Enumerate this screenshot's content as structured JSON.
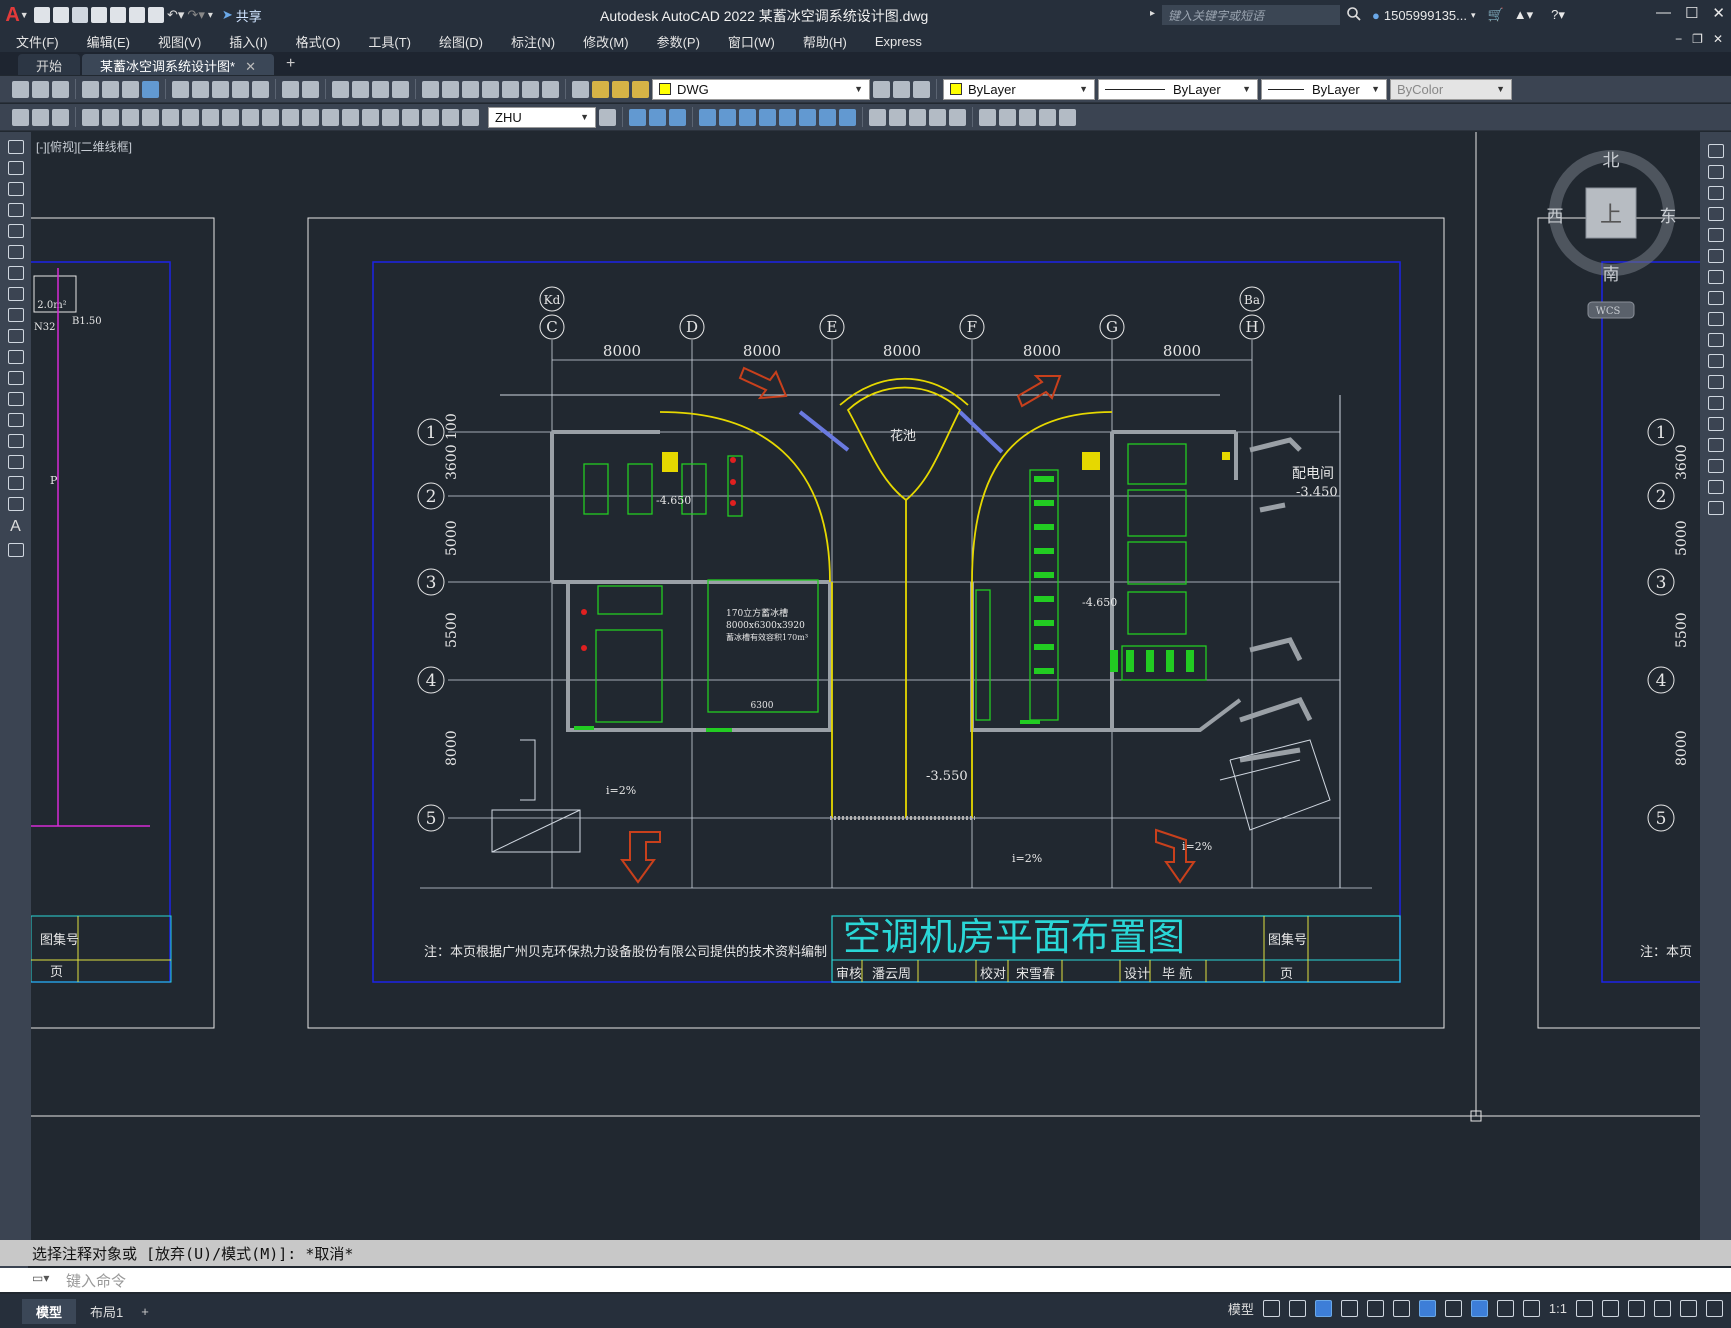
{
  "app": {
    "logo": "A",
    "window_title": "Autodesk AutoCAD 2022    某蓄冰空调系统设计图.dwg",
    "share": "共享"
  },
  "search": {
    "placeholder": "键入关键字或短语"
  },
  "user": {
    "name": "1505999135..."
  },
  "menu": [
    "文件(F)",
    "编辑(E)",
    "视图(V)",
    "插入(I)",
    "格式(O)",
    "工具(T)",
    "绘图(D)",
    "标注(N)",
    "修改(M)",
    "参数(P)",
    "窗口(W)",
    "帮助(H)",
    "Express"
  ],
  "tabs": [
    {
      "label": "开始"
    },
    {
      "label": "某蓄冰空调系统设计图*"
    }
  ],
  "toolbar": {
    "layer": "DWG",
    "color": "ByLayer",
    "linetype": "ByLayer",
    "lineweight": "ByLayer",
    "plotstyle": "ByColor",
    "dimstyle": "ZHU"
  },
  "viewport": {
    "label": "[-][俯视][二维线框]"
  },
  "viewcube": {
    "north": "北",
    "south": "南",
    "east": "东",
    "west": "西",
    "face": "上",
    "wcs": "WCS"
  },
  "drawing": {
    "title": "空调机房平面布置图",
    "note": "注：本页根据广州贝克环保热力设备股份有限公司提供的技术资料编制",
    "atlas_label": "图集号",
    "page_label": "页",
    "review_label": "审核",
    "reviewer": "潘云周",
    "check_label": "校对",
    "checker": "宋雪春",
    "design_label": "设计",
    "designer": "毕 航",
    "axes_top": [
      "C",
      "D",
      "E",
      "F",
      "G",
      "H"
    ],
    "axis_kd": "Kd",
    "axis_ba": "Ba",
    "spans": [
      "8000",
      "8000",
      "8000",
      "8000",
      "8000"
    ],
    "axes_left": [
      "1",
      "2",
      "3",
      "4",
      "5"
    ],
    "spans_left": [
      "3600",
      "5000",
      "5500",
      "8000"
    ],
    "spans_left_extra": "100",
    "flower_bed": "花池",
    "elev1": "-3.550",
    "elev2": "-3.450",
    "elev3": "-4.650",
    "elev4": "-4.650",
    "slope": "i=2%",
    "room_substation": "配电间",
    "tank_label": "170立方蓄冰槽",
    "tank_size": "8000x6300x3920",
    "tank_note": "蓄冰槽有效容积170m³",
    "dim_6300": "6300",
    "left_sheet_area": "2.0m²",
    "left_sheet_n32": "N32",
    "left_sheet_b150": "B1.50",
    "left_sheet_p": "P",
    "right_note": "注：本页"
  },
  "command": {
    "history": "选择注释对象或 [放弃(U)/模式(M)]: *取消*",
    "prompt": "键入命令"
  },
  "status": {
    "model_tab": "模型",
    "layout_tab": "布局1",
    "model_label": "模型",
    "scale": "1:1"
  }
}
